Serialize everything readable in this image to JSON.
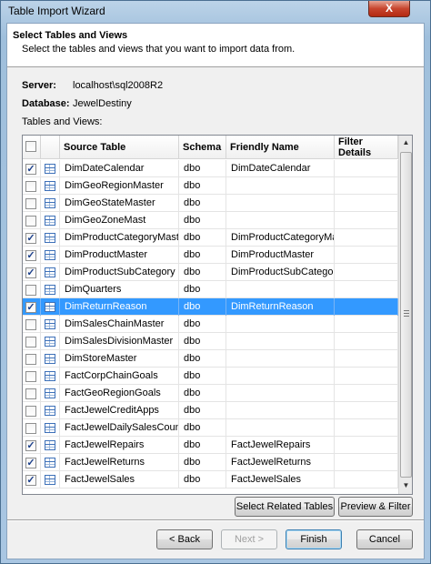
{
  "window": {
    "title": "Table Import Wizard",
    "close_glyph": "X"
  },
  "header": {
    "title": "Select Tables and Views",
    "description": "Select the tables and views that you want to import data from."
  },
  "info": {
    "server_label": "Server:",
    "server_value": "localhost\\sql2008R2",
    "database_label": "Database:",
    "database_value": "JewelDestiny",
    "tables_label": "Tables and Views:"
  },
  "grid": {
    "columns": [
      "Source Table",
      "Schema",
      "Friendly Name",
      "Filter Details"
    ],
    "rows": [
      {
        "checked": true,
        "source": "DimDateCalendar",
        "schema": "dbo",
        "friendly": "DimDateCalendar",
        "filter": "",
        "selected": false
      },
      {
        "checked": false,
        "source": "DimGeoRegionMaster",
        "schema": "dbo",
        "friendly": "",
        "filter": "",
        "selected": false
      },
      {
        "checked": false,
        "source": "DimGeoStateMaster",
        "schema": "dbo",
        "friendly": "",
        "filter": "",
        "selected": false
      },
      {
        "checked": false,
        "source": "DimGeoZoneMast",
        "schema": "dbo",
        "friendly": "",
        "filter": "",
        "selected": false
      },
      {
        "checked": true,
        "source": "DimProductCategoryMaster",
        "schema": "dbo",
        "friendly": "DimProductCategoryMas...",
        "filter": "",
        "selected": false
      },
      {
        "checked": true,
        "source": "DimProductMaster",
        "schema": "dbo",
        "friendly": "DimProductMaster",
        "filter": "",
        "selected": false
      },
      {
        "checked": true,
        "source": "DimProductSubCategory",
        "schema": "dbo",
        "friendly": "DimProductSubCategory",
        "filter": "",
        "selected": false
      },
      {
        "checked": false,
        "source": "DimQuarters",
        "schema": "dbo",
        "friendly": "",
        "filter": "",
        "selected": false
      },
      {
        "checked": true,
        "source": "DimReturnReason",
        "schema": "dbo",
        "friendly": "DimReturnReason",
        "filter": "",
        "selected": true
      },
      {
        "checked": false,
        "source": "DimSalesChainMaster",
        "schema": "dbo",
        "friendly": "",
        "filter": "",
        "selected": false
      },
      {
        "checked": false,
        "source": "DimSalesDivisionMaster",
        "schema": "dbo",
        "friendly": "",
        "filter": "",
        "selected": false
      },
      {
        "checked": false,
        "source": "DimStoreMaster",
        "schema": "dbo",
        "friendly": "",
        "filter": "",
        "selected": false
      },
      {
        "checked": false,
        "source": "FactCorpChainGoals",
        "schema": "dbo",
        "friendly": "",
        "filter": "",
        "selected": false
      },
      {
        "checked": false,
        "source": "FactGeoRegionGoals",
        "schema": "dbo",
        "friendly": "",
        "filter": "",
        "selected": false
      },
      {
        "checked": false,
        "source": "FactJewelCreditApps",
        "schema": "dbo",
        "friendly": "",
        "filter": "",
        "selected": false
      },
      {
        "checked": false,
        "source": "FactJewelDailySalesCounts",
        "schema": "dbo",
        "friendly": "",
        "filter": "",
        "selected": false
      },
      {
        "checked": true,
        "source": "FactJewelRepairs",
        "schema": "dbo",
        "friendly": "FactJewelRepairs",
        "filter": "",
        "selected": false
      },
      {
        "checked": true,
        "source": "FactJewelReturns",
        "schema": "dbo",
        "friendly": "FactJewelReturns",
        "filter": "",
        "selected": false
      },
      {
        "checked": true,
        "source": "FactJewelSales",
        "schema": "dbo",
        "friendly": "FactJewelSales",
        "filter": "",
        "selected": false
      }
    ]
  },
  "buttons": {
    "select_related": "Select Related Tables",
    "preview_filter": "Preview & Filter",
    "back": "< Back",
    "next": "Next >",
    "finish": "Finish",
    "cancel": "Cancel"
  },
  "icons": {
    "checkbox_checked": "✓",
    "scroll_up": "▲",
    "scroll_down": "▼"
  },
  "colors": {
    "selection": "#3399ff",
    "window_frame": "#a9c6e2",
    "close_button": "#c7452e"
  }
}
